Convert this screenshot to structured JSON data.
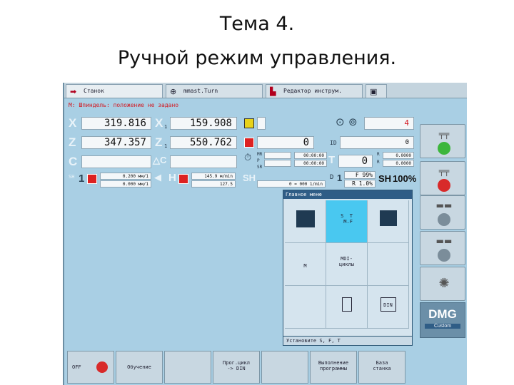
{
  "slide": {
    "title_line1": "Тема 4.",
    "title_line2": "Ручной режим управления."
  },
  "tabs": [
    {
      "label": "Станок",
      "icon": "arrow-icon"
    },
    {
      "label": "mmast.Turn",
      "icon": "program-icon"
    },
    {
      "label": "Редактор инструм.",
      "icon": "tool-editor-icon"
    },
    {
      "label": "",
      "icon": "save-icon"
    }
  ],
  "alarm": "M: Шпиндель: положение не задано",
  "axes": {
    "x_label": "X",
    "x_value": "319.816",
    "x1_label": "X",
    "x1_value": "159.908",
    "z_label": "Z",
    "z_value": "347.357",
    "z1_label": "Z",
    "z1_value": "550.762",
    "c_label": "C",
    "c_value": "",
    "delta_c_label": "△C",
    "delta_c_value": "",
    "sub1": "1",
    "sub2": "1"
  },
  "right_fields": {
    "tool_value": "0",
    "id_label": "ID",
    "id_value": "0",
    "t_label": "T",
    "t_value": "0",
    "d_label": "D",
    "d_value": "1",
    "mr": "MR",
    "p": "P",
    "sr": "SR",
    "timer1": "00:00:00",
    "timer2": "00:00:00",
    "r_label": "R",
    "r1": "0.0000",
    "r2": "0.0000",
    "f_value": "F   99%",
    "r_value": "R  1.0%",
    "sh_label": "SH",
    "sh_value": "100%",
    "spindle_indicator": "4"
  },
  "feed": {
    "sh_label": "SH",
    "sh_index": "1",
    "feed1": "0.200 мм/1",
    "feed2": "0.000 мм/1",
    "h_label": "H",
    "h_feed1": "145.9 м/min",
    "h_feed2": "127.5",
    "sh_right": "SH",
    "speed": "0 = 000 1/min"
  },
  "menu": {
    "title": "Главное меню",
    "cells": [
      {
        "label": ""
      },
      {
        "label": "S  T\n M.F"
      },
      {
        "label": ""
      },
      {
        "label": "M"
      },
      {
        "label": "MDI-\nциклы"
      },
      {
        "label": ""
      },
      {
        "label": ""
      },
      {
        "label": ""
      },
      {
        "label": "DIN"
      }
    ],
    "status": "Установите S, F, T"
  },
  "right_softkeys": [
    {
      "icon": "coolant-on-icon",
      "color": "#3cb63c"
    },
    {
      "icon": "coolant-off-icon",
      "color": "#d82a2a"
    },
    {
      "icon": "chuck-icon",
      "color": "#7b8d9a"
    },
    {
      "icon": "tailstock-icon",
      "color": "#7b8d9a"
    },
    {
      "icon": "light-icon",
      "color": "#7b8d9a"
    }
  ],
  "dmg": {
    "logo": "DMG",
    "sub": "Custom"
  },
  "bottom_softkeys": [
    {
      "line1": "OFF",
      "line2": ""
    },
    {
      "line1": "Обучение",
      "line2": ""
    },
    {
      "line1": "",
      "line2": ""
    },
    {
      "line1": "Прог.цикл",
      "line2": "-> DIN"
    },
    {
      "line1": "",
      "line2": ""
    },
    {
      "line1": "Выполнение",
      "line2": "программы"
    },
    {
      "line1": "База",
      "line2": "станка"
    }
  ],
  "colors": {
    "screen_bg": "#a9cfe4",
    "menu_title": "#2f5d86",
    "selected": "#49c8f0",
    "alarm": "#d3171f"
  }
}
